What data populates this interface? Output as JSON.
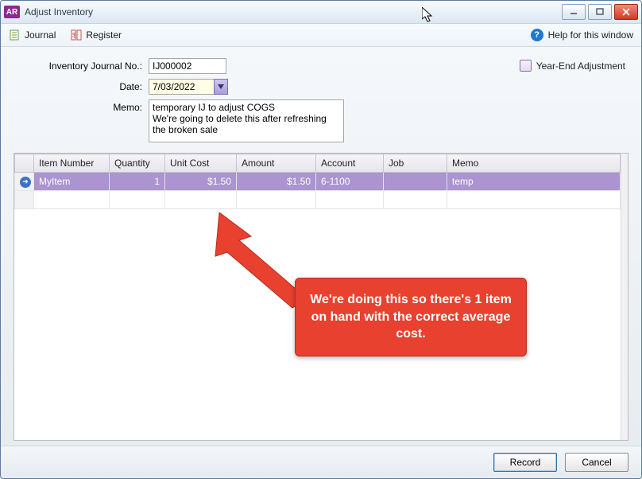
{
  "window": {
    "title": "Adjust Inventory"
  },
  "toolbar": {
    "journal": "Journal",
    "register": "Register",
    "help": "Help for this window"
  },
  "form": {
    "labels": {
      "journal_no": "Inventory Journal No.:",
      "date": "Date:",
      "memo": "Memo:"
    },
    "journal_no": "IJ000002",
    "date": "7/03/2022",
    "memo": "temporary IJ to adjust COGS\nWe're going to delete this after refreshing the broken sale",
    "year_end_label": "Year-End Adjustment"
  },
  "grid": {
    "headers": {
      "item": "Item Number",
      "qty": "Quantity",
      "unit": "Unit Cost",
      "amount": "Amount",
      "account": "Account",
      "job": "Job",
      "memo": "Memo"
    },
    "rows": [
      {
        "item": "MyItem",
        "qty": "1",
        "unit": "$1.50",
        "amount": "$1.50",
        "account": "6-1100",
        "job": "",
        "memo": "temp"
      }
    ]
  },
  "footer": {
    "record": "Record",
    "cancel": "Cancel"
  },
  "annotation": {
    "text": "We're doing this so there's 1 item on hand with the correct average cost."
  }
}
